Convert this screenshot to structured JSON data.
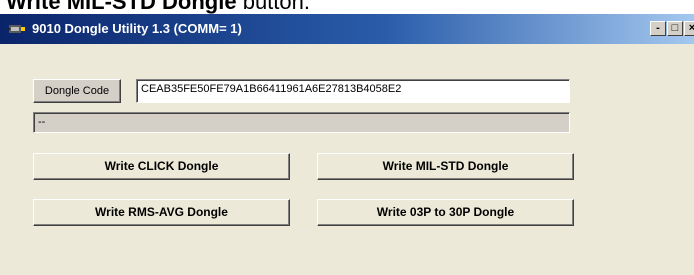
{
  "doc_caption": {
    "bold": "Write MIL-STD Dongle",
    "rest": " button."
  },
  "window": {
    "title": "9010 Dongle Utility 1.3 (COMM= 1)"
  },
  "window_controls": {
    "minimize": "-",
    "maximize": "□",
    "close": "×"
  },
  "dongle": {
    "label_button": "Dongle Code",
    "code_value": "CEAB35FE50FE79A1B66411961A6E27813B4058E2",
    "status_text": "--"
  },
  "buttons": {
    "write_click": "Write CLICK Dongle",
    "write_mil_std": "Write MIL-STD Dongle",
    "write_rms_avg": "Write RMS-AVG Dongle",
    "write_03p_30p": "Write 03P to 30P Dongle"
  },
  "icons": {
    "app": "app-icon",
    "minimize": "minimize-icon",
    "maximize": "maximize-icon",
    "close": "close-icon"
  },
  "colors": {
    "titlebar_start": "#0a246a",
    "titlebar_end": "#a6caf0",
    "face": "#d4d0c8",
    "button_face": "#ece9d8"
  }
}
